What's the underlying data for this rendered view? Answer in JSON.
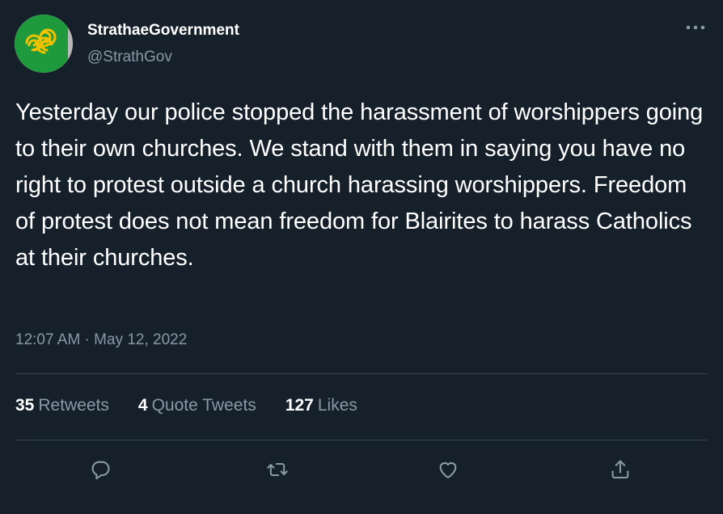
{
  "author": {
    "display_name": "StrathaeGovernment",
    "handle": "@StrathGov"
  },
  "tweet": {
    "text": "Yesterday our police stopped the harassment of worshippers going to their own churches. We stand with them in saying you have no right to protest outside a church harassing worshippers. Freedom of protest does not mean freedom for Blairites to harass Catholics at their churches.",
    "time": "12:07 AM",
    "separator": "·",
    "date": "May 12, 2022"
  },
  "stats": {
    "retweets_count": "35",
    "retweets_label": "Retweets",
    "quotes_count": "4",
    "quotes_label": "Quote Tweets",
    "likes_count": "127",
    "likes_label": "Likes"
  },
  "icons": {
    "more": "more-icon",
    "reply": "reply-icon",
    "retweet": "retweet-icon",
    "like": "like-icon",
    "share": "share-icon"
  },
  "colors": {
    "background": "#15202b",
    "secondary_text": "#8899a6",
    "divider": "#38444d",
    "avatar_green": "#1e9a3c",
    "avatar_gold": "#f2c200"
  }
}
